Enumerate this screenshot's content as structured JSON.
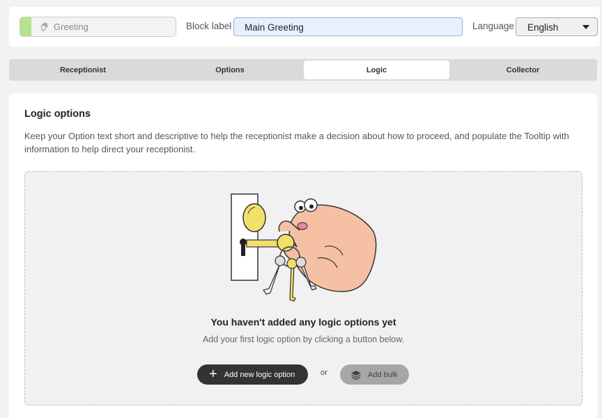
{
  "header": {
    "block_type": "Greeting",
    "block_type_icon": "hand-wave-icon",
    "block_label_caption": "Block label",
    "block_label_value": "Main Greeting",
    "language_caption": "Language",
    "language_value": "English"
  },
  "tabs": [
    {
      "label": "Receptionist"
    },
    {
      "label": "Options"
    },
    {
      "label": "Logic",
      "active": true
    },
    {
      "label": "Collector"
    }
  ],
  "logic": {
    "title": "Logic options",
    "description": "Keep your Option text short and descriptive to help the receptionist make a decision about how to proceed, and populate the Tooltip with information to help direct your receptionist.",
    "empty_title": "You haven't added any logic options yet",
    "empty_subtitle": "Add your first logic option by clicking a button below.",
    "add_button": "Add new logic option",
    "add_button_icon": "plus-icon",
    "or_text": "or",
    "bulk_button": "Add bulk",
    "bulk_button_icon": "layers-icon",
    "illustration": "hand-with-keys-illustration"
  },
  "colors": {
    "accent_green": "#b6e38d",
    "input_bg": "#e8f0fe",
    "primary_button": "#333333",
    "disabled_button": "#a6a6a6"
  }
}
